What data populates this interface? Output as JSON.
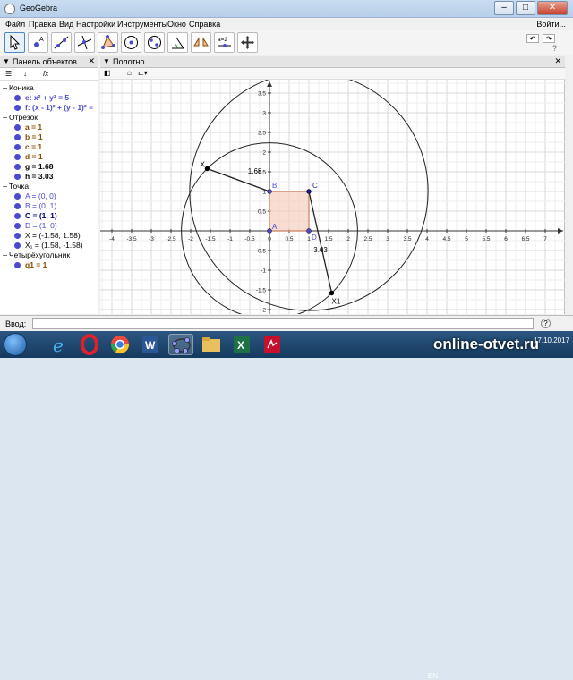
{
  "window": {
    "title": "GeoGebra",
    "buttons": [
      "–",
      "□",
      "✕"
    ]
  },
  "menu": {
    "items": [
      "Файл",
      "Правка",
      "Вид",
      "Настройки",
      "Инструменты",
      "Окно",
      "Справка"
    ],
    "login": "Войти..."
  },
  "toolbar": {
    "tools": [
      "move-tool",
      "point-tool",
      "line-tool",
      "perpendicular-tool",
      "polygon-tool",
      "circle-center-point-tool",
      "ellipse-tool",
      "angle-tool",
      "reflect-tool",
      "slider-tool",
      "move-graphics-tool"
    ],
    "slider_label": "a=2",
    "undo": "↶",
    "redo": "↷",
    "help": "?"
  },
  "algebra": {
    "title": "Панель объектов",
    "toolbar_sort": "↓",
    "toolbar_fx": "fx",
    "groups": [
      {
        "label": "Коника",
        "items": [
          {
            "text": "e: x² + y² = 5",
            "color": "#4a4ad0",
            "bold": true
          },
          {
            "text": "f: (x - 1)² + (y - 1)² =",
            "color": "#4a4ad0",
            "bold": true
          }
        ]
      },
      {
        "label": "Отрезок",
        "items": [
          {
            "text": "a = 1",
            "color": "#8b4a00",
            "bold": true
          },
          {
            "text": "b = 1",
            "color": "#8b4a00",
            "bold": true
          },
          {
            "text": "c = 1",
            "color": "#8b4a00",
            "bold": true
          },
          {
            "text": "d = 1",
            "color": "#8b4a00",
            "bold": true
          },
          {
            "text": "g = 1.68",
            "color": "#000000",
            "bold": true
          },
          {
            "text": "h = 3.03",
            "color": "#000000",
            "bold": true
          }
        ]
      },
      {
        "label": "Точка",
        "items": [
          {
            "text": "A = (0, 0)",
            "color": "#4a4ad0",
            "bold": false
          },
          {
            "text": "B = (0, 1)",
            "color": "#4a4ad0",
            "bold": false
          },
          {
            "text": "C = (1, 1)",
            "color": "#000080",
            "bold": true
          },
          {
            "text": "D = (1, 0)",
            "color": "#4a4ad0",
            "bold": false
          },
          {
            "text": "X = (-1.58, 1.58)",
            "color": "#000000",
            "bold": false
          },
          {
            "text": "X₁ = (1.58, -1.58)",
            "color": "#000000",
            "bold": false
          }
        ]
      },
      {
        "label": "Четырёхугольник",
        "items": [
          {
            "text": "q1 = 1",
            "color": "#8b4a00",
            "bold": true
          }
        ]
      }
    ]
  },
  "graphics": {
    "title": "Полотно",
    "x_ticks": [
      -4,
      -3.5,
      -3,
      -2.5,
      -2,
      -1.5,
      -1,
      -0.5,
      0,
      0.5,
      1,
      1.5,
      2,
      2.5,
      3,
      3.5,
      4,
      4.5,
      5,
      5.5,
      6,
      6.5,
      7
    ],
    "y_ticks": [
      -2,
      -1.5,
      -1,
      -0.5,
      0.5,
      1,
      1.5,
      2,
      2.5,
      3,
      3.5
    ],
    "circles": [
      {
        "name": "e",
        "cx": 0,
        "cy": 0,
        "r": 2.2361
      },
      {
        "name": "f",
        "cx": 1,
        "cy": 1,
        "r": 3.0265
      }
    ],
    "square": {
      "points": [
        [
          0,
          0
        ],
        [
          1,
          0
        ],
        [
          1,
          1
        ],
        [
          0,
          1
        ]
      ],
      "fill": "#f5cfc0",
      "stroke": "#c88060"
    },
    "points": [
      {
        "label": "A",
        "x": 0,
        "y": 0,
        "color": "#4a4ad0",
        "dx": 3,
        "dy": -2
      },
      {
        "label": "B",
        "x": 0,
        "y": 1,
        "color": "#4a4ad0",
        "dx": 3,
        "dy": -4
      },
      {
        "label": "C",
        "x": 1,
        "y": 1,
        "color": "#1a1a8a",
        "dx": 4,
        "dy": -4
      },
      {
        "label": "D",
        "x": 1,
        "y": 0,
        "color": "#4a4ad0",
        "dx": 3,
        "dy": 10
      },
      {
        "label": "X",
        "x": -1.58,
        "y": 1.58,
        "color": "#000000",
        "dx": -8,
        "dy": -2
      },
      {
        "label": "X1",
        "x": 1.58,
        "y": -1.58,
        "color": "#000000",
        "dx": 0,
        "dy": 12
      }
    ],
    "segments": [
      {
        "from": [
          -1.58,
          1.58
        ],
        "to": [
          0,
          1
        ],
        "label": "1.68",
        "lx": -0.55,
        "ly": 1.45
      },
      {
        "from": [
          1,
          1
        ],
        "to": [
          1.58,
          -1.58
        ],
        "label": "3.03",
        "lx": 1.12,
        "ly": -0.55
      }
    ]
  },
  "inputbar": {
    "label": "Ввод:",
    "help": "?"
  },
  "taskbar": {
    "apps": [
      "start-orb",
      "ie-icon",
      "opera-icon",
      "chrome-icon",
      "word-icon",
      "geogebra-icon",
      "folder-icon",
      "excel-icon",
      "pdf-icon"
    ],
    "lang": "EN",
    "date": "17.10.2017"
  },
  "watermark": "online-otvet.ru"
}
